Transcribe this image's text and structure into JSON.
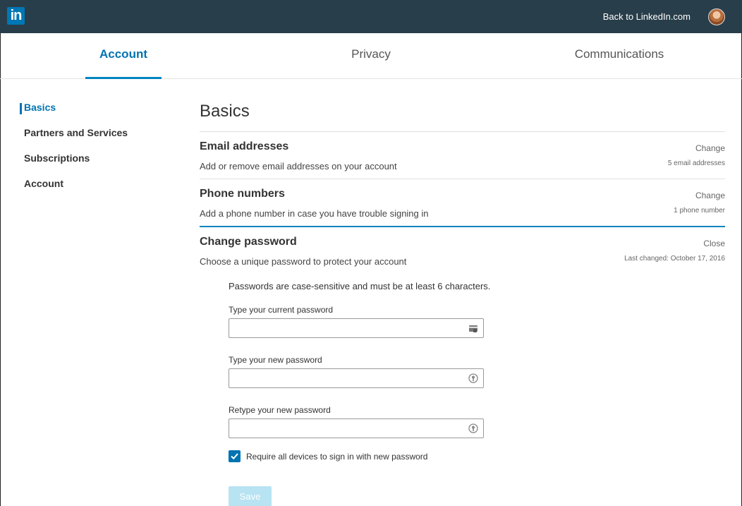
{
  "app": {
    "logo_text": "in",
    "back_link": "Back to LinkedIn.com",
    "brand_color": "#0077b5",
    "topbar_color": "#283e4a"
  },
  "tabs": [
    {
      "label": "Account",
      "active": true
    },
    {
      "label": "Privacy",
      "active": false
    },
    {
      "label": "Communications",
      "active": false
    }
  ],
  "sidebar": {
    "items": [
      {
        "label": "Basics",
        "active": true
      },
      {
        "label": "Partners and Services",
        "active": false
      },
      {
        "label": "Subscriptions",
        "active": false
      },
      {
        "label": "Account",
        "active": false
      }
    ]
  },
  "main": {
    "title": "Basics",
    "email": {
      "title": "Email addresses",
      "description": "Add or remove email addresses on your account",
      "action": "Change",
      "meta": "5 email addresses"
    },
    "phone": {
      "title": "Phone numbers",
      "description": "Add a phone number in case you have trouble signing in",
      "action": "Change",
      "meta": "1 phone number"
    },
    "password": {
      "title": "Change password",
      "description": "Choose a unique password to protect your account",
      "action": "Close",
      "meta": "Last changed: October 17, 2016",
      "note": "Passwords are case-sensitive and must be at least 6 characters.",
      "current_label": "Type your current password",
      "current_value": "",
      "current_icon": "password-manager-icon",
      "new_label": "Type your new password",
      "new_value": "",
      "new_icon": "key-icon",
      "retype_label": "Retype your new password",
      "retype_value": "",
      "retype_icon": "key-icon",
      "require_label": "Require all devices to sign in with new password",
      "require_checked": true,
      "save_label": "Save"
    }
  }
}
